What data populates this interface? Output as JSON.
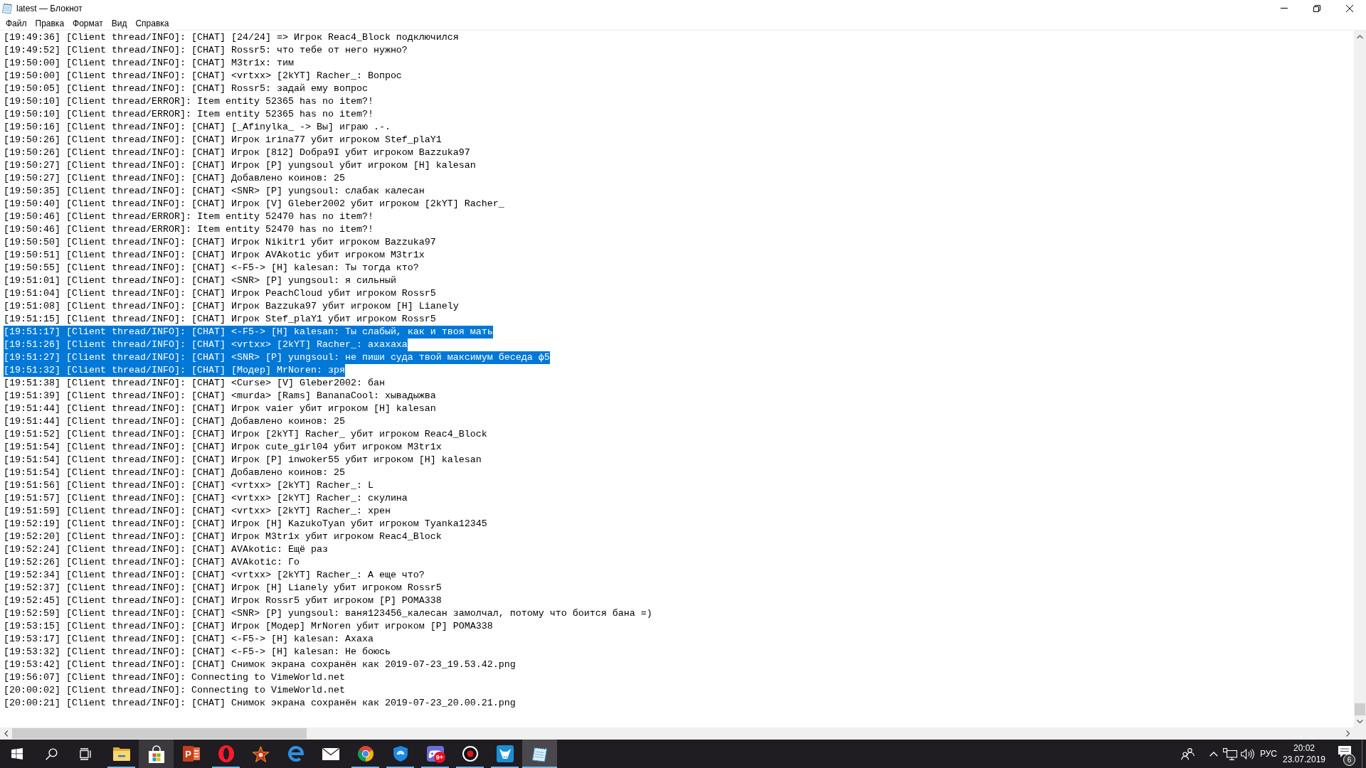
{
  "window": {
    "title": "latest — Блокнот"
  },
  "menu": [
    "Файл",
    "Правка",
    "Формат",
    "Вид",
    "Справка"
  ],
  "lines": [
    {
      "text": "[19:49:36] [Client thread/INFO]: [CHAT] [24/24] => Игрок Reac4_Block подключился",
      "selected": false
    },
    {
      "text": "[19:49:52] [Client thread/INFO]: [CHAT] Rossr5: что тебе от него нужно?",
      "selected": false
    },
    {
      "text": "[19:50:00] [Client thread/INFO]: [CHAT] M3tr1x: тим",
      "selected": false
    },
    {
      "text": "[19:50:00] [Client thread/INFO]: [CHAT] <vrtxx> [2kYT] Racher_: Вопрос",
      "selected": false
    },
    {
      "text": "[19:50:05] [Client thread/INFO]: [CHAT] Rossr5: задай ему вопрос",
      "selected": false
    },
    {
      "text": "[19:50:10] [Client thread/ERROR]: Item entity 52365 has no item?!",
      "selected": false
    },
    {
      "text": "[19:50:10] [Client thread/ERROR]: Item entity 52365 has no item?!",
      "selected": false
    },
    {
      "text": "[19:50:16] [Client thread/INFO]: [CHAT] [_Afinylka_ -> Вы] играю .-.",
      "selected": false
    },
    {
      "text": "[19:50:26] [Client thread/INFO]: [CHAT] Игрок irina77 убит игроком Stef_plaY1",
      "selected": false
    },
    {
      "text": "[19:50:26] [Client thread/INFO]: [CHAT] Игрок [812] Doбpa9I убит игроком Bazzuka97",
      "selected": false
    },
    {
      "text": "[19:50:27] [Client thread/INFO]: [CHAT] Игрок [P] yungsoul убит игроком [H] kalesan",
      "selected": false
    },
    {
      "text": "[19:50:27] [Client thread/INFO]: [CHAT] Добавлено коинов: 25",
      "selected": false
    },
    {
      "text": "[19:50:35] [Client thread/INFO]: [CHAT] <SNR> [P] yungsoul: слабак калесан",
      "selected": false
    },
    {
      "text": "[19:50:40] [Client thread/INFO]: [CHAT] Игрок [V] Gleber2002 убит игроком [2kYT] Racher_",
      "selected": false
    },
    {
      "text": "[19:50:46] [Client thread/ERROR]: Item entity 52470 has no item?!",
      "selected": false
    },
    {
      "text": "[19:50:46] [Client thread/ERROR]: Item entity 52470 has no item?!",
      "selected": false
    },
    {
      "text": "[19:50:50] [Client thread/INFO]: [CHAT] Игрок Nikitr1 убит игроком Bazzuka97",
      "selected": false
    },
    {
      "text": "[19:50:51] [Client thread/INFO]: [CHAT] Игрок AVAkotic убит игроком M3tr1x",
      "selected": false
    },
    {
      "text": "[19:50:55] [Client thread/INFO]: [CHAT] <-F5-> [H] kalesan: Ты тогда кто?",
      "selected": false
    },
    {
      "text": "[19:51:01] [Client thread/INFO]: [CHAT] <SNR> [P] yungsoul: я сильный",
      "selected": false
    },
    {
      "text": "[19:51:04] [Client thread/INFO]: [CHAT] Игрок PeachCloud убит игроком Rossr5",
      "selected": false
    },
    {
      "text": "[19:51:08] [Client thread/INFO]: [CHAT] Игрок Bazzuka97 убит игроком [H] Lianely",
      "selected": false
    },
    {
      "text": "[19:51:15] [Client thread/INFO]: [CHAT] Игрок Stef_plaY1 убит игроком Rossr5",
      "selected": false
    },
    {
      "text": "[19:51:17] [Client thread/INFO]: [CHAT] <-F5-> [H] kalesan: Ты слабый, как и твоя мать",
      "selected": true
    },
    {
      "text": "[19:51:26] [Client thread/INFO]: [CHAT] <vrtxx> [2kYT] Racher_: ахахаха",
      "selected": true
    },
    {
      "text": "[19:51:27] [Client thread/INFO]: [CHAT] <SNR> [P] yungsoul: не пиши суда твой максимум беседа ф5",
      "selected": true
    },
    {
      "text": "[19:51:32] [Client thread/INFO]: [CHAT] [Модер] MrNoren: зря",
      "selected": true
    },
    {
      "text": "[19:51:38] [Client thread/INFO]: [CHAT] <Curse> [V] Gleber2002: бан",
      "selected": false
    },
    {
      "text": "[19:51:39] [Client thread/INFO]: [CHAT] <murda> [Rams] BananaCool: хывадыжва",
      "selected": false
    },
    {
      "text": "[19:51:44] [Client thread/INFO]: [CHAT] Игрок vaier убит игроком [H] kalesan",
      "selected": false
    },
    {
      "text": "[19:51:44] [Client thread/INFO]: [CHAT] Добавлено коинов: 25",
      "selected": false
    },
    {
      "text": "[19:51:52] [Client thread/INFO]: [CHAT] Игрок [2kYT] Racher_ убит игроком Reac4_Block",
      "selected": false
    },
    {
      "text": "[19:51:54] [Client thread/INFO]: [CHAT] Игрок cute_girl04 убит игроком M3tr1x",
      "selected": false
    },
    {
      "text": "[19:51:54] [Client thread/INFO]: [CHAT] Игрок [P] inwoker55 убит игроком [H] kalesan",
      "selected": false
    },
    {
      "text": "[19:51:54] [Client thread/INFO]: [CHAT] Добавлено коинов: 25",
      "selected": false
    },
    {
      "text": "[19:51:56] [Client thread/INFO]: [CHAT] <vrtxx> [2kYT] Racher_: L",
      "selected": false
    },
    {
      "text": "[19:51:57] [Client thread/INFO]: [CHAT] <vrtxx> [2kYT] Racher_: скулина",
      "selected": false
    },
    {
      "text": "[19:51:59] [Client thread/INFO]: [CHAT] <vrtxx> [2kYT] Racher_: хрен",
      "selected": false
    },
    {
      "text": "[19:52:19] [Client thread/INFO]: [CHAT] Игрок [H] KazukoTyan убит игроком Tyanka12345",
      "selected": false
    },
    {
      "text": "[19:52:20] [Client thread/INFO]: [CHAT] Игрок M3tr1x убит игроком Reac4_Block",
      "selected": false
    },
    {
      "text": "[19:52:24] [Client thread/INFO]: [CHAT] AVAkotic: Ещё раз",
      "selected": false
    },
    {
      "text": "[19:52:26] [Client thread/INFO]: [CHAT] AVAkotic: Го",
      "selected": false
    },
    {
      "text": "[19:52:34] [Client thread/INFO]: [CHAT] <vrtxx> [2kYT] Racher_: А еще что?",
      "selected": false
    },
    {
      "text": "[19:52:37] [Client thread/INFO]: [CHAT] Игрок [H] Lianely убит игроком Rossr5",
      "selected": false
    },
    {
      "text": "[19:52:45] [Client thread/INFO]: [CHAT] Игрок Rossr5 убит игроком [P] POMA338",
      "selected": false
    },
    {
      "text": "[19:52:59] [Client thread/INFO]: [CHAT] <SNR> [P] yungsoul: ваня123456_калесан замолчал, потому что боится бана =)",
      "selected": false
    },
    {
      "text": "[19:53:15] [Client thread/INFO]: [CHAT] Игрок [Модер] MrNoren убит игроком [P] POMA338",
      "selected": false
    },
    {
      "text": "[19:53:17] [Client thread/INFO]: [CHAT] <-F5-> [H] kalesan: Ахаха",
      "selected": false
    },
    {
      "text": "[19:53:32] [Client thread/INFO]: [CHAT] <-F5-> [H] kalesan: Не боюсь",
      "selected": false
    },
    {
      "text": "[19:53:42] [Client thread/INFO]: [CHAT] Снимок экрана сохранён как 2019-07-23_19.53.42.png",
      "selected": false
    },
    {
      "text": "[19:56:07] [Client thread/INFO]: Connecting to VimeWorld.net",
      "selected": false
    },
    {
      "text": "[20:00:02] [Client thread/INFO]: Connecting to VimeWorld.net",
      "selected": false
    },
    {
      "text": "[20:00:21] [Client thread/INFO]: [CHAT] Снимок экрана сохранён как 2019-07-23_20.00.21.png",
      "selected": false
    }
  ],
  "taskbar": {
    "apps": [
      {
        "kind": "folder",
        "running": true,
        "active": false,
        "hovered": false
      },
      {
        "kind": "bag",
        "running": false,
        "active": false,
        "hovered": true
      },
      {
        "kind": "slides",
        "label": "P",
        "running": false,
        "active": false,
        "hovered": false
      },
      {
        "kind": "ring",
        "running": true,
        "active": false,
        "hovered": false
      },
      {
        "kind": "star",
        "running": false,
        "active": false,
        "hovered": false
      },
      {
        "kind": "swirl",
        "running": false,
        "active": false,
        "hovered": false
      },
      {
        "kind": "envelope",
        "running": false,
        "active": false,
        "hovered": false
      },
      {
        "kind": "wheel",
        "running": true,
        "active": false,
        "hovered": false
      },
      {
        "kind": "shield",
        "running": true,
        "active": false,
        "hovered": false
      },
      {
        "kind": "gamepad",
        "badge": "9+",
        "running": true,
        "active": false,
        "hovered": false
      },
      {
        "kind": "record",
        "running": true,
        "active": false,
        "hovered": false
      },
      {
        "kind": "bull",
        "running": true,
        "active": false,
        "hovered": false
      },
      {
        "kind": "notepad",
        "running": true,
        "active": true,
        "hovered": false
      }
    ],
    "tray": {
      "language": "РУС",
      "time": "20:02",
      "date": "23.07.2019",
      "notification_count": "6"
    }
  }
}
